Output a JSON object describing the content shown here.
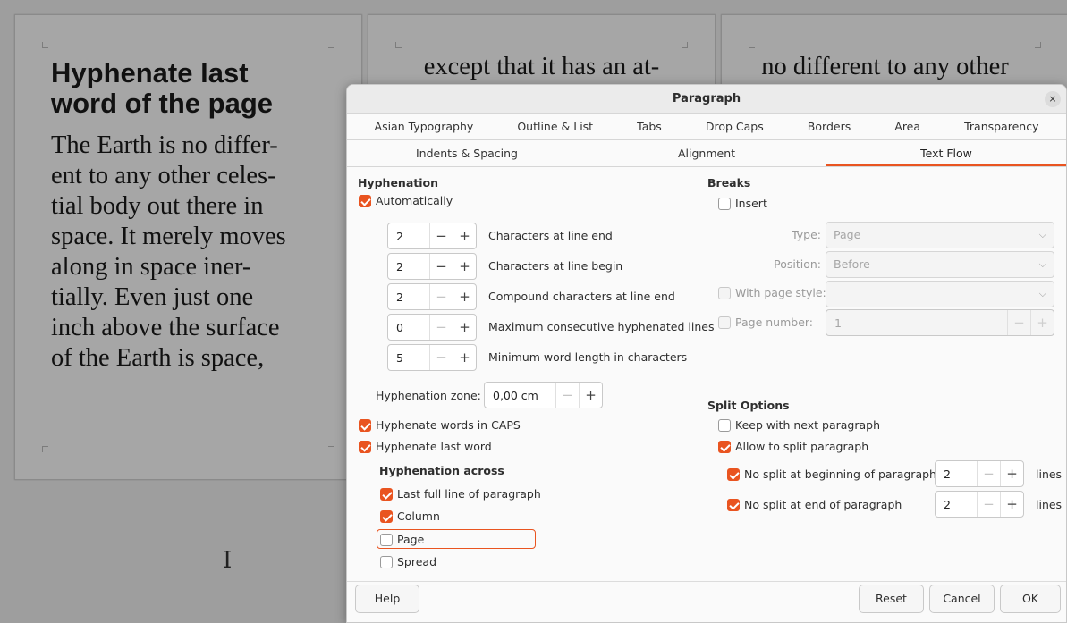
{
  "document": {
    "page1": {
      "heading_lines": [
        "Hyphenate last",
        "word of the page"
      ],
      "body_lines": [
        "The Earth is no differ-",
        "ent to any other celes-",
        "tial body out there in",
        "space. It merely moves",
        "along in space iner-",
        "tially. Even just one",
        "inch above the surface",
        "of the Earth is space,"
      ]
    },
    "page2": {
      "top_line": "except that it has an at-"
    },
    "page3": {
      "top_line": "no different to any other"
    }
  },
  "dialog": {
    "title": "Paragraph",
    "close_glyph": "×",
    "tabs_row1": [
      "Asian Typography",
      "Outline & List",
      "Tabs",
      "Drop Caps",
      "Borders",
      "Area",
      "Transparency"
    ],
    "tabs_row2": [
      "Indents & Spacing",
      "Alignment",
      "Text Flow"
    ],
    "active_tab": "Text Flow",
    "hyphenation": {
      "title": "Hyphenation",
      "automatically": {
        "label": "Automatically",
        "checked": true
      },
      "chars_line_end": {
        "value": "2",
        "label": "Characters at line end"
      },
      "chars_line_begin": {
        "value": "2",
        "label": "Characters at line begin"
      },
      "compound_chars": {
        "value": "2",
        "label": "Compound characters at line end"
      },
      "max_consecutive": {
        "value": "0",
        "label": "Maximum consecutive hyphenated lines"
      },
      "min_word_length": {
        "value": "5",
        "label": "Minimum word length in characters"
      },
      "zone": {
        "label": "Hyphenation zone:",
        "value": "0,00 cm"
      },
      "words_in_caps": {
        "label": "Hyphenate words in CAPS",
        "checked": true
      },
      "last_word": {
        "label": "Hyphenate last word",
        "checked": true
      },
      "across_title": "Hyphenation across",
      "across_last_full_line": {
        "label": "Last full line of paragraph",
        "checked": true
      },
      "across_column": {
        "label": "Column",
        "checked": true
      },
      "across_page": {
        "label": "Page",
        "checked": false
      },
      "across_spread": {
        "label": "Spread",
        "checked": false
      }
    },
    "breaks": {
      "title": "Breaks",
      "insert": {
        "label": "Insert",
        "checked": false
      },
      "type_label": "Type:",
      "type_value": "Page",
      "position_label": "Position:",
      "position_value": "Before",
      "with_page_style": {
        "label": "With page style:",
        "checked": false
      },
      "page_style_value": "",
      "page_number": {
        "label": "Page number:",
        "checked": false
      },
      "page_number_value": "1"
    },
    "split": {
      "title": "Split Options",
      "keep_with_next": {
        "label": "Keep with next paragraph",
        "checked": false
      },
      "allow_split": {
        "label": "Allow to split paragraph",
        "checked": true
      },
      "no_split_beginning": {
        "label": "No split at beginning of paragraph",
        "checked": true,
        "value": "2",
        "unit": "lines"
      },
      "no_split_end": {
        "label": "No split at end of paragraph",
        "checked": true,
        "value": "2",
        "unit": "lines"
      }
    },
    "buttons": {
      "help": "Help",
      "reset": "Reset",
      "cancel": "Cancel",
      "ok": "OK"
    },
    "spin_minus": "−",
    "spin_plus": "+",
    "chevron": "⌵"
  },
  "cursor_glyph": "I",
  "colors": {
    "accent": "#e95420",
    "canvas": "#9e9e9e",
    "page": "#a6a6a6"
  }
}
